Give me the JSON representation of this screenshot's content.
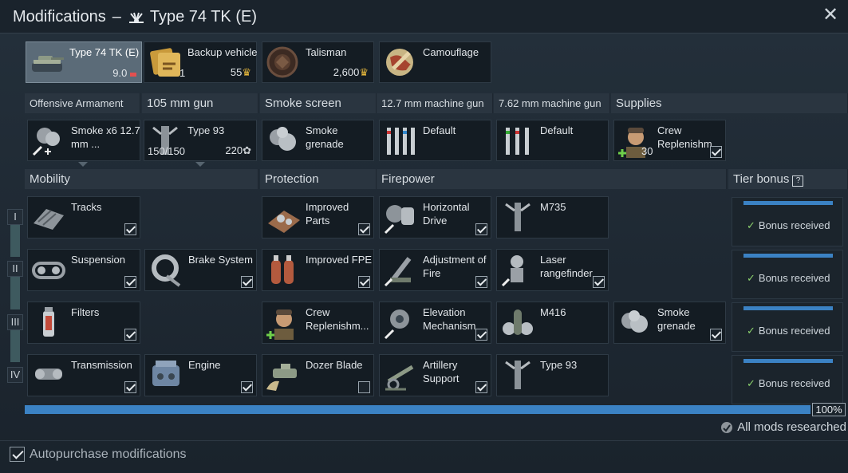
{
  "window": {
    "title": "Modifications",
    "dash": "–",
    "vehicle_name": "Type 74 TK (E)",
    "close_symbol": "✕"
  },
  "top_row": [
    {
      "name": "vehicle",
      "label": "Type 74 TK (E)",
      "value": "9.0"
    },
    {
      "name": "backup-vehicle",
      "label": "Backup vehicle",
      "left": "1",
      "value": "55"
    },
    {
      "name": "talisman",
      "label": "Talisman",
      "value": "2,600"
    },
    {
      "name": "camouflage",
      "label": "Camouflage"
    }
  ],
  "weapon_headers": [
    "Offensive Armament",
    "105 mm gun",
    "Smoke screen",
    "12.7 mm machine gun",
    "7.62 mm machine gun",
    "Supplies"
  ],
  "weapons": [
    {
      "label": "Smoke x6 12.7 mm ..."
    },
    {
      "label": "Type 93",
      "left": "150/150",
      "value": "220"
    },
    {
      "label": "Smoke grenade"
    },
    {
      "label": "Default"
    },
    {
      "label": "Default"
    },
    {
      "label": "Crew Replenishm...",
      "value": "30"
    }
  ],
  "section_headers": {
    "mobility": "Mobility",
    "protection": "Protection",
    "firepower": "Firepower",
    "tier_bonus": "Tier bonus",
    "help": "?"
  },
  "tiers": [
    "I",
    "II",
    "III",
    "IV"
  ],
  "mods": {
    "tracks": "Tracks",
    "suspension": "Suspension",
    "brake": "Brake System",
    "filters": "Filters",
    "transmission": "Transmission",
    "engine": "Engine",
    "improved_parts": "Improved Parts",
    "improved_fpe": "Improved FPE",
    "crew_replenishment": "Crew Replenishm...",
    "dozer_blade": "Dozer Blade",
    "horizontal_drive": "Horizontal Drive",
    "m735": "M735",
    "adjustment_of_fire": "Adjustment of Fire",
    "laser_rangefinder": "Laser rangefinder",
    "elevation_mechanism": "Elevation Mechanism",
    "m416": "M416",
    "smoke_grenade": "Smoke grenade",
    "artillery_support": "Artillery Support",
    "type93": "Type 93"
  },
  "bonus_text": "Bonus received",
  "progress": {
    "percent": "100%",
    "value": 1.0
  },
  "all_mods": "All mods researched",
  "autopurchase": "Autopurchase modifications",
  "colors": {
    "accent": "#3b82c4",
    "check": "#8bd16d",
    "panel": "#141c23"
  }
}
